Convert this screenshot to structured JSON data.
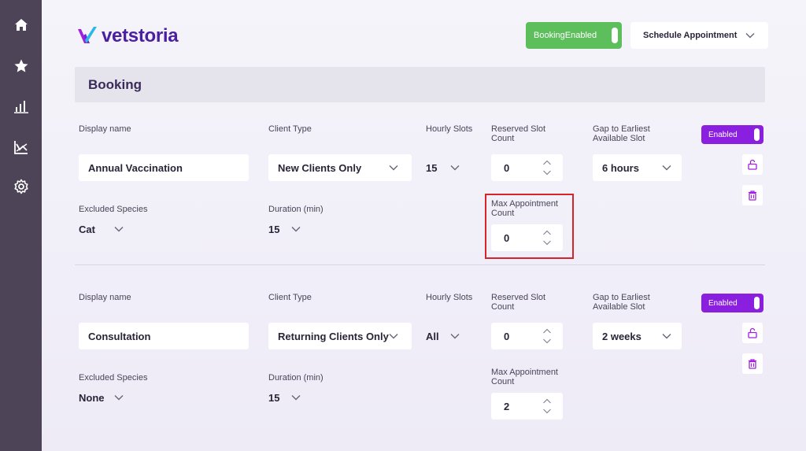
{
  "app": {
    "logo_text": "vetstoria"
  },
  "sidebar": {
    "items": [
      {
        "icon": "home-icon"
      },
      {
        "icon": "star-icon"
      },
      {
        "icon": "bar-chart-icon"
      },
      {
        "icon": "analytics-icon"
      },
      {
        "icon": "gear-icon"
      }
    ]
  },
  "header": {
    "booking_toggle_label": "BookingEnabled",
    "schedule_label": "Schedule Appointment"
  },
  "section": {
    "title": "Booking"
  },
  "labels": {
    "display_name": "Display name",
    "client_type": "Client Type",
    "hourly_slots": "Hourly Slots",
    "reserved_slot_count_1": "Reserved Slot",
    "reserved_slot_count_2": "Count",
    "gap_1": "Gap to Earliest",
    "gap_2": "Available Slot",
    "excluded_species": "Excluded Species",
    "duration": "Duration (min)",
    "max_appt_1": "Max Appointment",
    "max_appt_2": "Count",
    "enabled": "Enabled"
  },
  "rows": [
    {
      "display_name": "Annual Vaccination",
      "client_type": "New Clients Only",
      "hourly_slots": "15",
      "reserved_slot_count": "0",
      "gap": "6 hours",
      "excluded_species": "Cat",
      "duration": "15",
      "max_appointment_count": "0"
    },
    {
      "display_name": "Consultation",
      "client_type": "Returning Clients Only",
      "hourly_slots": "All",
      "reserved_slot_count": "0",
      "gap": "2 weeks",
      "excluded_species": "None",
      "duration": "15",
      "max_appointment_count": "2"
    }
  ],
  "colors": {
    "sidebar": "#4d4458",
    "brand": "#4a1fa0",
    "enabled": "#8a1fe0",
    "booking_enabled": "#5cbf5c",
    "highlight": "#d7232b"
  }
}
